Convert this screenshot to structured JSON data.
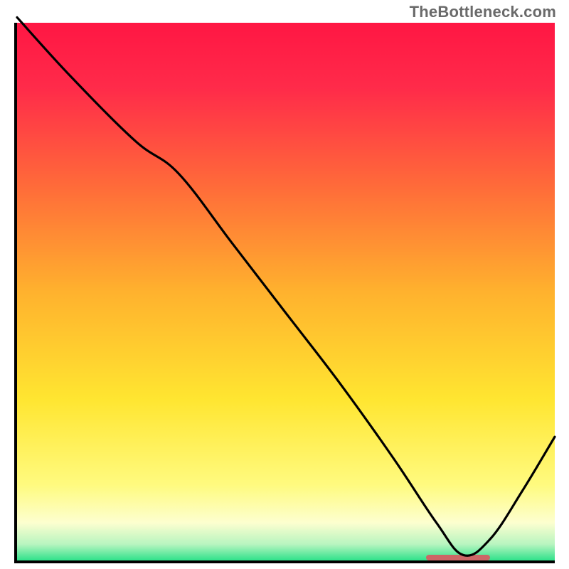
{
  "watermark": "TheBottleneck.com",
  "chart_data": {
    "type": "line",
    "title": "",
    "xlabel": "",
    "ylabel": "",
    "xlim": [
      0,
      100
    ],
    "ylim": [
      0,
      100
    ],
    "grid": false,
    "background_gradient": [
      {
        "stop": 0.0,
        "color": "#ff1744"
      },
      {
        "stop": 0.12,
        "color": "#ff2b4a"
      },
      {
        "stop": 0.3,
        "color": "#ff6a3a"
      },
      {
        "stop": 0.5,
        "color": "#ffb22e"
      },
      {
        "stop": 0.7,
        "color": "#ffe631"
      },
      {
        "stop": 0.86,
        "color": "#fffb80"
      },
      {
        "stop": 0.93,
        "color": "#fdffd0"
      },
      {
        "stop": 0.97,
        "color": "#b8f5c0"
      },
      {
        "stop": 1.0,
        "color": "#2fe28b"
      }
    ],
    "series": [
      {
        "name": "bottleneck-curve",
        "x": [
          0,
          10,
          22,
          30,
          40,
          50,
          60,
          70,
          78,
          83,
          88,
          94,
          100
        ],
        "y": [
          101,
          90,
          78,
          72,
          59,
          46,
          33,
          19,
          7,
          1,
          4,
          13,
          23
        ]
      }
    ],
    "annotations": [
      {
        "name": "optimal-range-marker",
        "type": "band",
        "axis": "x",
        "start": 76,
        "end": 88,
        "y": 0.5,
        "color": "#cc6666"
      }
    ]
  }
}
